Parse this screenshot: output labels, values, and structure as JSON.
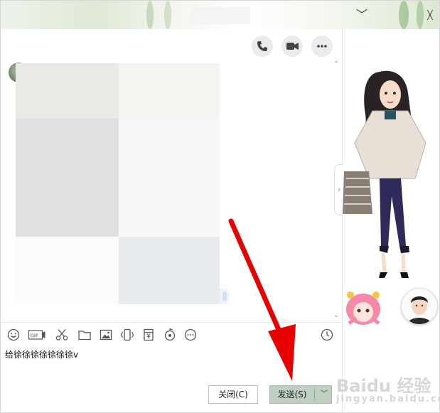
{
  "titlebar": {
    "minimize_glyph": "﹀",
    "close_glyph": "╳"
  },
  "message_input": {
    "value": "给徐徐徐徐徐徐徐v"
  },
  "buttons": {
    "close_label": "关闭(C)",
    "send_label": "发送(S)",
    "send_menu_glyph": "﹀"
  },
  "icons": [
    "phone-icon",
    "video-icon",
    "more-icon",
    "emoji-icon",
    "gif-icon",
    "scissors-icon",
    "folder-icon",
    "image-icon",
    "shake-icon",
    "red-packet-icon",
    "music-icon",
    "more-tools-icon",
    "history-clock-icon"
  ],
  "watermark": {
    "text": "Baidu 经验",
    "sub": "jingyan.baidu.com"
  },
  "colors": {
    "annotation_arrow": "#e60000",
    "send_button_bg": "#bfcfc2"
  }
}
